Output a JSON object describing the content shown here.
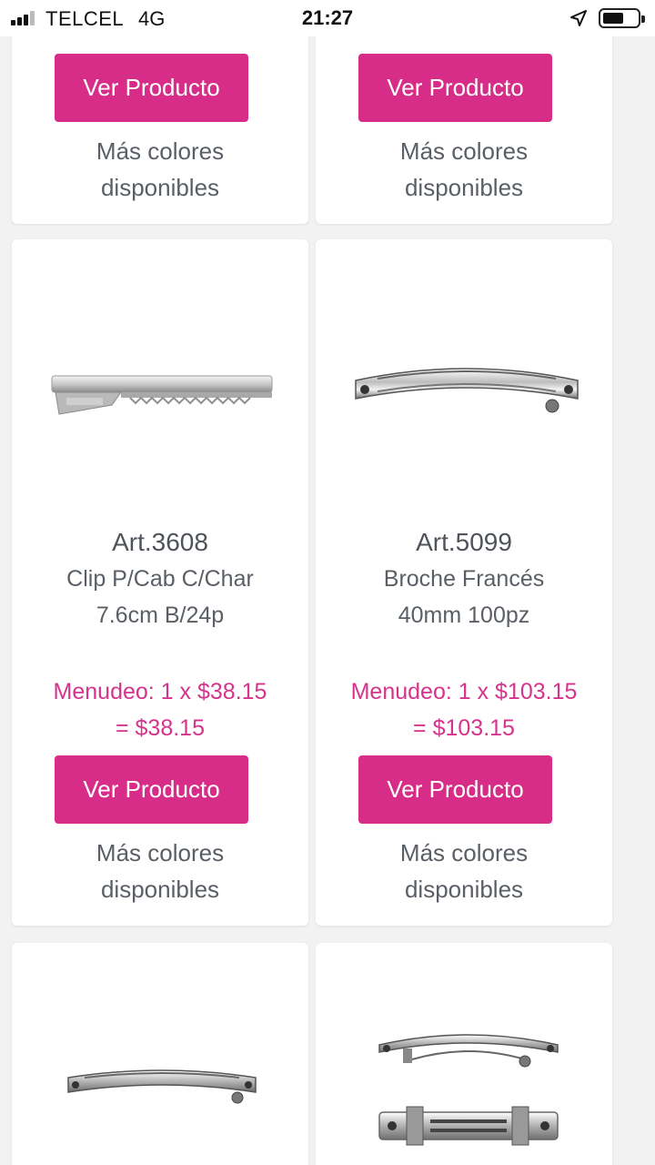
{
  "status": {
    "carrier": "TELCEL",
    "network": "4G",
    "time": "21:27"
  },
  "cards_top": [
    {
      "button": "Ver Producto",
      "colors_line1": "Más colores",
      "colors_line2": "disponibles"
    },
    {
      "button": "Ver Producto",
      "colors_line1": "Más colores",
      "colors_line2": "disponibles"
    }
  ],
  "products": [
    {
      "art": "Art.3608",
      "desc_line1": "Clip P/Cab C/Char",
      "desc_line2": "7.6cm B/24p",
      "price_line1": "Menudeo: 1 x $38.15",
      "price_line2": "= $38.15",
      "button": "Ver Producto",
      "colors_line1": "Más colores",
      "colors_line2": "disponibles"
    },
    {
      "art": "Art.5099",
      "desc_line1": "Broche Francés",
      "desc_line2": "40mm 100pz",
      "price_line1": "Menudeo: 1 x $103.15",
      "price_line2": "= $103.15",
      "button": "Ver Producto",
      "colors_line1": "Más colores",
      "colors_line2": "disponibles"
    }
  ],
  "colors": {
    "accent": "#d82c89",
    "price": "#d6338d"
  }
}
